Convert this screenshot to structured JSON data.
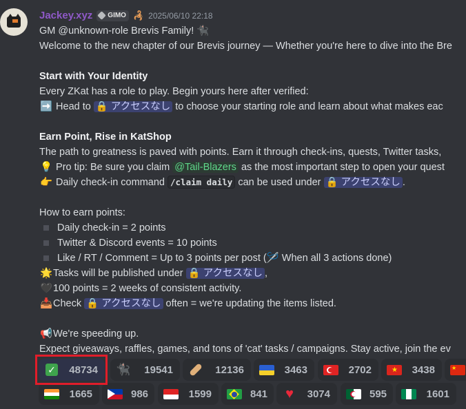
{
  "message": {
    "username": "Jackey.xyz",
    "server_tag": "GIMO",
    "timestamp": "2025/06/10 22:18",
    "lines": {
      "l1_pre": "GM @unknown-role Brevis Family! ",
      "l1_emoji": "🐈‍⬛",
      "l2": "Welcome to the new chapter of our Brevis journey — Whether you're here to dive into the Bre",
      "h1": "Start with Your Identity",
      "l3": "Every ZKat has a role to play. Begin yours here after verified:",
      "l4_emoji": "➡️",
      "l4_pre": " Head to ",
      "l4_mention": "🔒 アクセスなし",
      "l4_post": "  to choose your starting role and learn about what makes eac",
      "h2": "Earn Point, Rise in KatShop",
      "l5": "The path to greatness is paved with points. Earn it through check-ins, quests, Twitter tasks,",
      "l6_emoji": "💡",
      "l6_pre": " Pro tip: Be sure you claim ",
      "l6_role": "@Tail-Blazers",
      "l6_post": " as the most important step to open your quest",
      "l7_emoji": "👉",
      "l7_pre": " Daily check-in command ",
      "l7_code": "/claim daily",
      "l7_mid": " can be used under ",
      "l7_mention": "🔒 アクセスなし",
      "l7_post": ".",
      "l8": "How to earn points:",
      "b1": "Daily check-in = 2 points",
      "b2": "Twitter & Discord events = 10 points",
      "b3_pre": "Like / RT / Comment = Up to 3 points per post (",
      "b3_emoji": "🪡",
      "b3_post": " When all 3 actions done)",
      "l9_emoji": "🌟",
      "l9_pre": "Tasks will be published under ",
      "l9_mention": "🔒 アクセスなし",
      "l9_post": ",",
      "l10_emoji": "🖤",
      "l10": "100 points = 2 weeks of consistent activity.",
      "l11_emoji": "📥",
      "l11_pre": "Check ",
      "l11_mention": "🔒 アクセスなし",
      "l11_post": " often = we're updating the items listed.",
      "l12_emoji": "📢",
      "l12": "We're speeding up.",
      "l13": "Expect giveaways, raffles, games, and tons of 'cat' tasks / campaigns. Stay active, join the ev"
    }
  },
  "reactions": [
    {
      "icon": "white-check-mark-icon",
      "emoji": "✅",
      "count": "48734",
      "active": true
    },
    {
      "icon": "black-cat-icon",
      "emoji": "🐈‍⬛",
      "count": "19541"
    },
    {
      "icon": "bandage-icon",
      "emoji": "🩹",
      "count": "12136"
    },
    {
      "icon": "ukraine-flag-icon",
      "emoji": "flag-ua",
      "count": "3463"
    },
    {
      "icon": "turkey-flag-icon",
      "emoji": "flag-tr",
      "count": "2702"
    },
    {
      "icon": "vietnam-flag-icon",
      "emoji": "flag-vn",
      "count": "3438"
    },
    {
      "icon": "china-flag-icon",
      "emoji": "flag-cn",
      "count": ""
    },
    {
      "icon": "india-flag-icon",
      "emoji": "flag-in",
      "count": "1665"
    },
    {
      "icon": "philippines-flag-icon",
      "emoji": "flag-ph",
      "count": "986"
    },
    {
      "icon": "indonesia-flag-icon",
      "emoji": "flag-id",
      "count": "1599"
    },
    {
      "icon": "brazil-flag-icon",
      "emoji": "flag-br",
      "count": "841"
    },
    {
      "icon": "red-heart-icon",
      "emoji": "❤️",
      "count": "3074"
    },
    {
      "icon": "algeria-flag-icon",
      "emoji": "flag-dz",
      "count": "595"
    },
    {
      "icon": "nigeria-flag-icon",
      "emoji": "flag-ng",
      "count": "1601"
    }
  ],
  "colors": {
    "background": "#313338",
    "username": "#8f59c8",
    "highlight": "#e11d2a",
    "mention_bg": "#3c4270",
    "role_mention": "#5fd78a"
  }
}
